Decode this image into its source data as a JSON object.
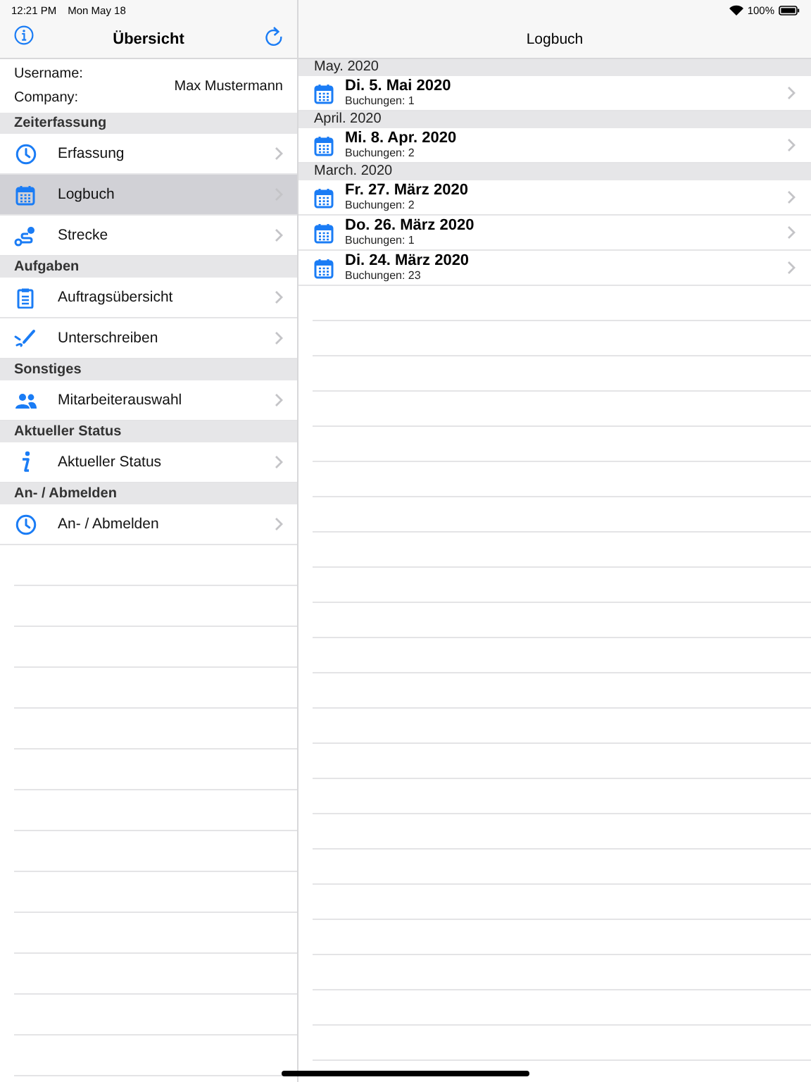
{
  "status_bar": {
    "time": "12:21 PM",
    "date": "Mon May 18",
    "battery": "100%"
  },
  "sidebar": {
    "title": "Übersicht",
    "user": {
      "username_label": "Username:",
      "company_label": "Company:",
      "name": "Max Mustermann"
    },
    "sections": [
      {
        "title": "Zeiterfassung",
        "items": [
          {
            "label": "Erfassung",
            "kind": "clock",
            "selected": false
          },
          {
            "label": "Logbuch",
            "kind": "calendar",
            "selected": true
          },
          {
            "label": "Strecke",
            "kind": "route",
            "selected": false
          }
        ]
      },
      {
        "title": "Aufgaben",
        "items": [
          {
            "label": "Auftragsübersicht",
            "kind": "clipboard",
            "selected": false
          },
          {
            "label": "Unterschreiben",
            "kind": "signature",
            "selected": false
          }
        ]
      },
      {
        "title": "Sonstiges",
        "items": [
          {
            "label": "Mitarbeiterauswahl",
            "kind": "people",
            "selected": false
          }
        ]
      },
      {
        "title": "Aktueller Status",
        "items": [
          {
            "label": "Aktueller Status",
            "kind": "info",
            "selected": false
          }
        ]
      },
      {
        "title": "An- / Abmelden",
        "items": [
          {
            "label": "An- / Abmelden",
            "kind": "clock",
            "selected": false
          }
        ]
      }
    ]
  },
  "logbook": {
    "title": "Logbuch",
    "groups": [
      {
        "title": "May. 2020",
        "entries": [
          {
            "date": "Di. 5. Mai 2020",
            "bookings": "Buchungen: 1"
          }
        ]
      },
      {
        "title": "April. 2020",
        "entries": [
          {
            "date": "Mi. 8. Apr. 2020",
            "bookings": "Buchungen: 2"
          }
        ]
      },
      {
        "title": "March. 2020",
        "entries": [
          {
            "date": "Fr. 27. März 2020",
            "bookings": "Buchungen: 2"
          },
          {
            "date": "Do. 26. März 2020",
            "bookings": "Buchungen: 1"
          },
          {
            "date": "Di. 24. März 2020",
            "bookings": "Buchungen: 23"
          }
        ]
      }
    ]
  }
}
